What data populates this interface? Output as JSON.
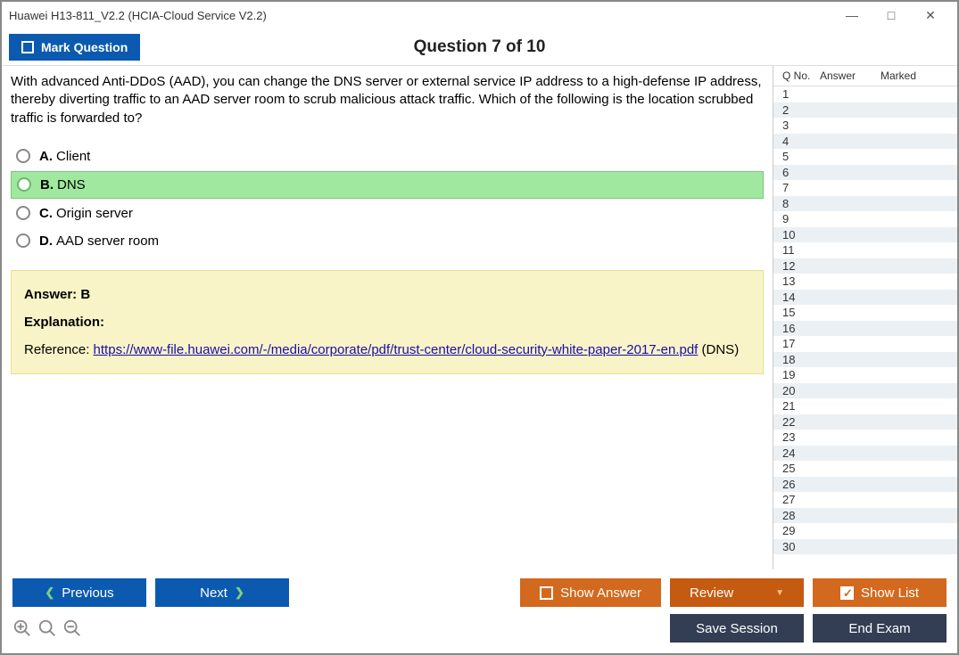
{
  "window": {
    "title": "Huawei H13-811_V2.2 (HCIA-Cloud Service V2.2)"
  },
  "toolbar": {
    "mark_label": "Mark Question",
    "heading": "Question 7 of 10"
  },
  "question": {
    "text": "With advanced Anti-DDoS (AAD), you can change the DNS server or external service IP address to a high-defense IP address, thereby diverting traffic to an AAD server room to scrub malicious attack traffic. Which of the following is the location scrubbed traffic is forwarded to?",
    "options": [
      {
        "letter": "A.",
        "text": "Client",
        "selected": false
      },
      {
        "letter": "B.",
        "text": "DNS",
        "selected": true
      },
      {
        "letter": "C.",
        "text": "Origin server",
        "selected": false
      },
      {
        "letter": "D.",
        "text": "AAD server room",
        "selected": false
      }
    ]
  },
  "answer_panel": {
    "answer_label": "Answer: B",
    "explanation_label": "Explanation:",
    "ref_prefix": "Reference: ",
    "ref_link": "https://www-file.huawei.com/-/media/corporate/pdf/trust-center/cloud-security-white-paper-2017-en.pdf",
    "ref_suffix": " (DNS)"
  },
  "sidepanel": {
    "col_qno": "Q No.",
    "col_answer": "Answer",
    "col_marked": "Marked",
    "row_count": 30
  },
  "buttons": {
    "previous": "Previous",
    "next": "Next",
    "show_answer": "Show Answer",
    "review": "Review",
    "show_list": "Show List",
    "save_session": "Save Session",
    "end_exam": "End Exam"
  }
}
